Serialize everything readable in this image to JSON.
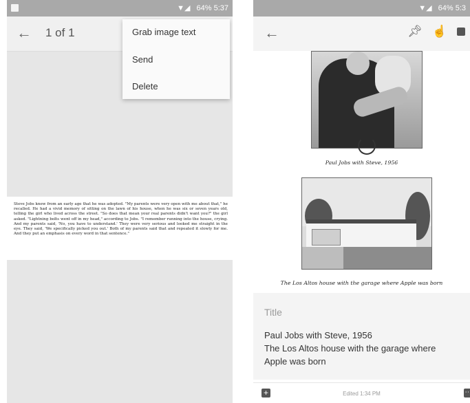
{
  "left_screen": {
    "status_bar": {
      "time": "64% 5:37"
    },
    "app_bar": {
      "back_glyph": "←",
      "counter": "1 of 1"
    },
    "overflow_menu": {
      "items": [
        {
          "label": "Grab image text"
        },
        {
          "label": "Send"
        },
        {
          "label": "Delete"
        }
      ]
    },
    "document_text": "Steve Jobs knew from an early age that he was adopted. \"My parents were very open with me about that,\" he recalled. He had a vivid memory of sitting on the lawn of his house, when he was six or seven years old, telling the girl who lived across the street. \"So does that mean your real parents didn't want you?\" the girl asked. \"Lightning bolts went off in my head,\" according to Jobs. \"I remember running into the house, crying. And my parents said, 'No, you have to understand.' They were very serious and looked me straight in the eye. They said, 'We specifically picked you out.' Both of my parents said that and repeated it slowly for me. And they put an emphasis on every word in that sentence.\""
  },
  "right_screen": {
    "status_bar": {
      "time": "64% 5:3"
    },
    "app_bar": {
      "back_glyph": "←",
      "icons": [
        "pin-icon",
        "reminder-icon",
        "archive-icon"
      ]
    },
    "captions": {
      "photo1": "Paul Jobs with Steve, 1956",
      "photo2": "The Los Altos house with the garage where Apple was born"
    },
    "note": {
      "title_placeholder": "Title",
      "body": "Paul Jobs with Steve, 1956\nThe Los Altos house with the garage where Apple was born"
    },
    "bottom_bar": {
      "edited": "Edited 1:34 PM",
      "add_glyph": "+",
      "more_glyph": "⋯"
    }
  },
  "colors": {
    "status_bar": "#a9a9a9",
    "menu_bg": "#fafafa",
    "note_bg": "#f4f4f4"
  }
}
